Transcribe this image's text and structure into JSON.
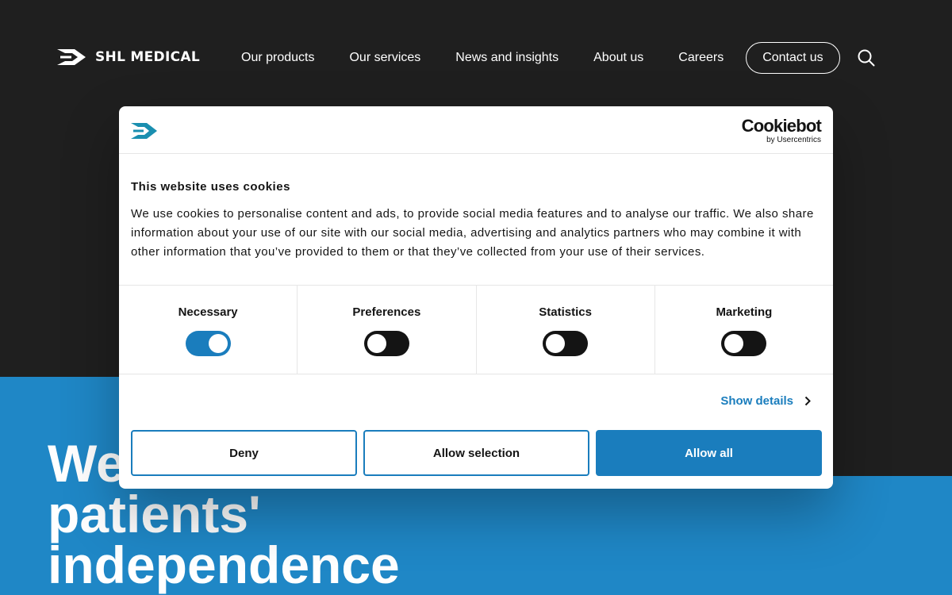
{
  "header": {
    "logo_text": "SHL MEDICAL",
    "nav": [
      {
        "label": "Our products"
      },
      {
        "label": "Our services"
      },
      {
        "label": "News and insights"
      },
      {
        "label": "About us"
      },
      {
        "label": "Careers"
      }
    ],
    "contact_label": "Contact us",
    "search_icon": "search-icon"
  },
  "hero": {
    "title_lines": [
      "We",
      "patients'",
      "independence"
    ]
  },
  "cookie_dialog": {
    "brand": "Cookiebot",
    "brand_by": "by Usercentrics",
    "title": "This website uses cookies",
    "text": "We use cookies to personalise content and ads, to provide social media features and to analyse our traffic. We also share information about your use of our site with our social media, advertising and analytics partners who may combine it with other information that you’ve provided to them or that they’ve collected from your use of their services.",
    "categories": [
      {
        "label": "Necessary",
        "checked": true
      },
      {
        "label": "Preferences",
        "checked": false
      },
      {
        "label": "Statistics",
        "checked": false
      },
      {
        "label": "Marketing",
        "checked": false
      }
    ],
    "show_details": "Show details",
    "buttons": {
      "deny": "Deny",
      "allow_selection": "Allow selection",
      "allow_all": "Allow all"
    }
  },
  "colors": {
    "accent": "#1a7dbd",
    "hero_blue": "#0077bf",
    "header_bg": "#000000"
  }
}
